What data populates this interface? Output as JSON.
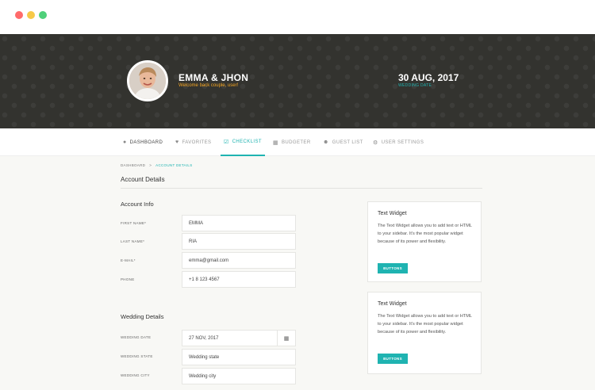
{
  "hero": {
    "name": "EMMA & JHON",
    "welcome": "Welcome back couple, user!",
    "date": "30 AUG, 2017",
    "date_label": "WEDDING DATE"
  },
  "nav": {
    "items": [
      {
        "label": "DASHBOARD",
        "icon": "dashboard-icon"
      },
      {
        "label": "FAVORITES",
        "icon": "heart-icon"
      },
      {
        "label": "CHECKLIST",
        "icon": "checklist-icon"
      },
      {
        "label": "BUDGETER",
        "icon": "calculator-icon"
      },
      {
        "label": "GUEST LIST",
        "icon": "guests-icon"
      },
      {
        "label": "USER SETTINGS",
        "icon": "gear-icon"
      }
    ],
    "active": "CHECKLIST"
  },
  "breadcrumb": {
    "items": [
      "DASHBOARD",
      "ACCOUNT DETAILS"
    ],
    "separator": ">"
  },
  "page_title": "Account Details",
  "account_info": {
    "title": "Account Info",
    "fields": [
      {
        "label": "FIRST NAME*",
        "value": "EMMA"
      },
      {
        "label": "LAST NAME*",
        "value": "RIA"
      },
      {
        "label": "E-MAIL*",
        "value": "emma@gmail.com"
      },
      {
        "label": "PHONE",
        "value": "+1 8 123 4567"
      }
    ]
  },
  "wedding_details": {
    "title": "Wedding Details",
    "fields": [
      {
        "label": "WEDDING DATE",
        "value": "27 NOV, 2017"
      },
      {
        "label": "WEDDING STATE",
        "placeholder": "Wedding state"
      },
      {
        "label": "WEDDING CITY",
        "placeholder": "Wedding city"
      }
    ]
  },
  "widgets": [
    {
      "title": "Text Widget",
      "body": "The Text Widget allows you to add text or HTML to your sidebar. It's the most popular widget because of its power and flexibility.",
      "button": "BUTTONS"
    },
    {
      "title": "Text Widget",
      "body": "The Text Widget allows you to add text or HTML to your sidebar. It's the most popular widget because of its power and flexibility.",
      "button": "BUTTONS"
    }
  ],
  "colors": {
    "accent": "#1fb3b1",
    "hero_bg": "#33332f",
    "welcome": "#f5a623"
  }
}
